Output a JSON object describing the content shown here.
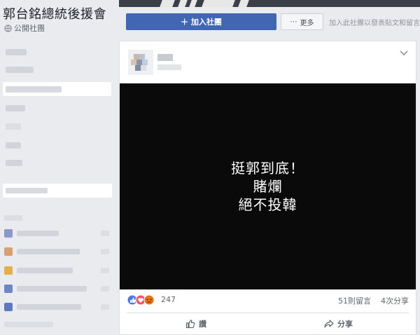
{
  "group": {
    "title": "郭台銘總統後援會",
    "type_label": "公開社團"
  },
  "actions": {
    "join_label": "＋ 加入社團",
    "more_label": "更多",
    "join_hint": "加入此社團以發表貼文和留言"
  },
  "post": {
    "slogan_lines": [
      "挺郭到底！",
      "賭爛",
      "絕不投韓"
    ],
    "reaction_count": "247",
    "comment_count": "51則留言",
    "share_count": "4次分享",
    "like_label": "讚",
    "share_label": "分享"
  },
  "colors": {
    "brand_blue": "#4267b2",
    "page_bg": "#e9ebee",
    "image_bg": "#0a0a0a"
  }
}
